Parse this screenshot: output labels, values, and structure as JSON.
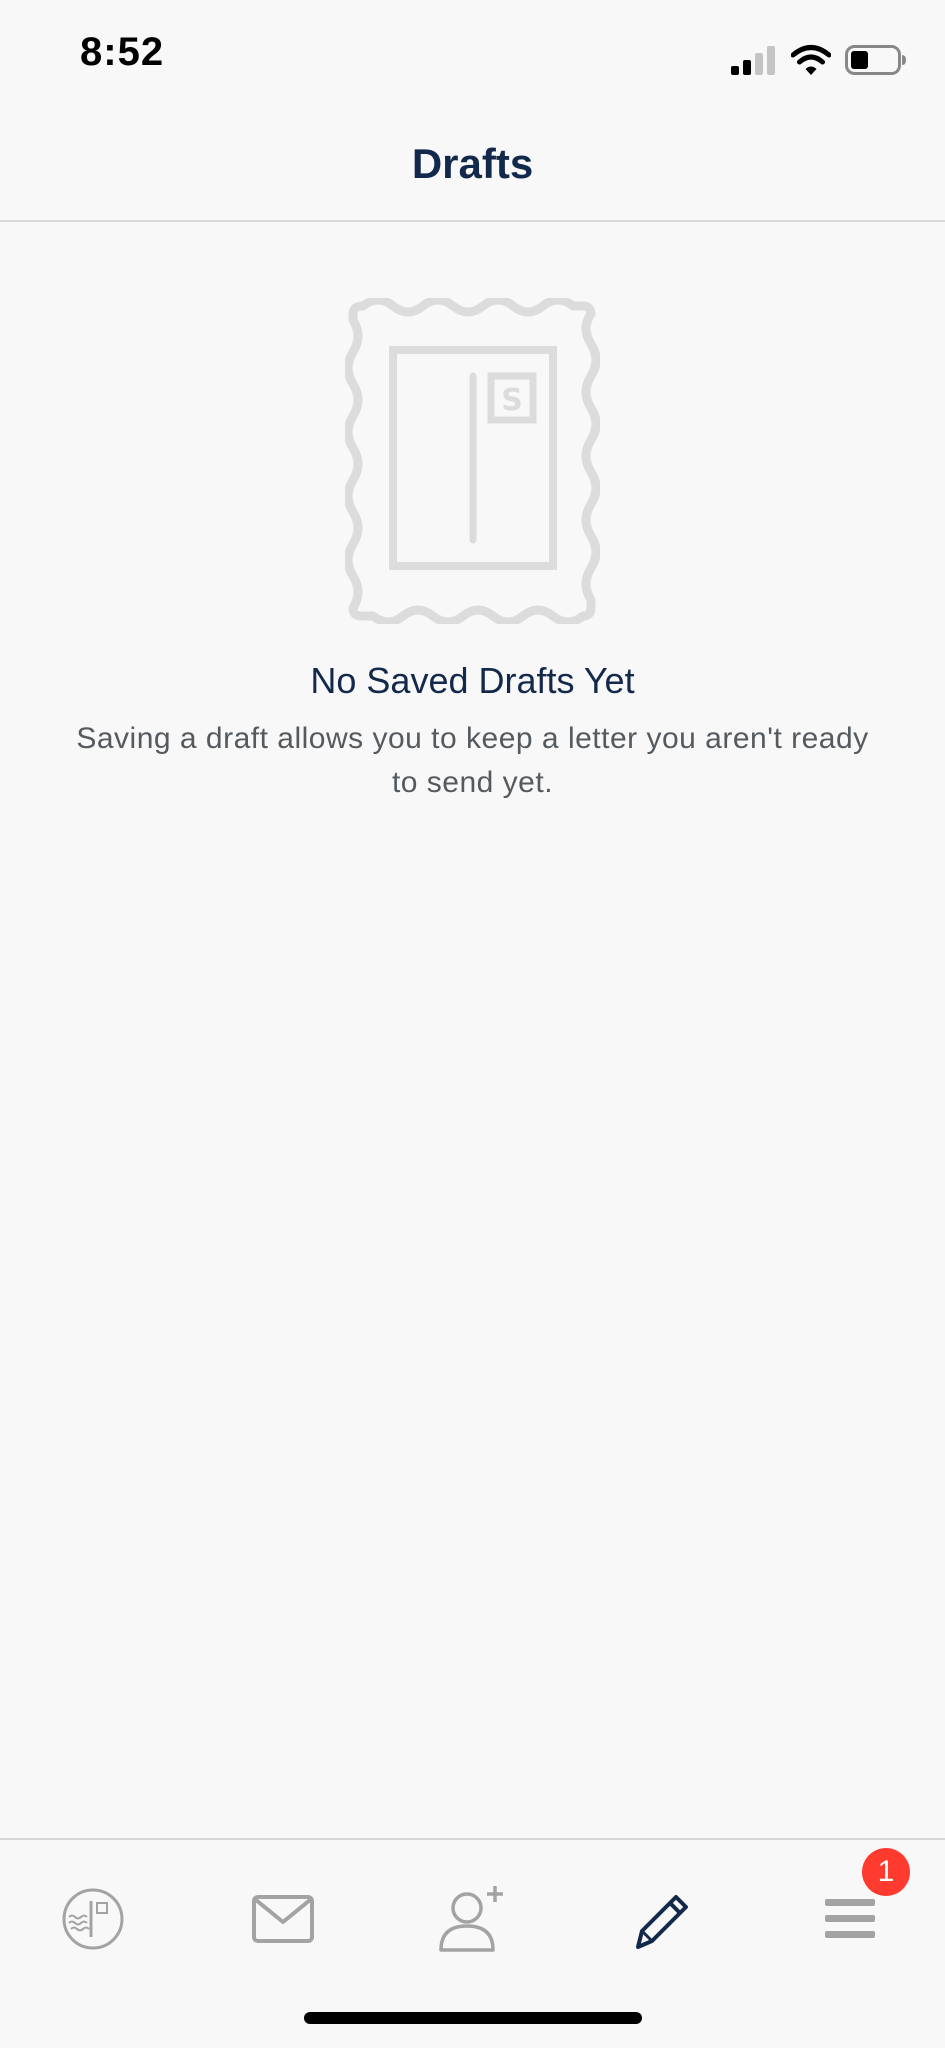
{
  "status_bar": {
    "time": "8:52"
  },
  "nav": {
    "title": "Drafts"
  },
  "empty_state": {
    "title": "No Saved Drafts Yet",
    "description": "Saving a draft allows you to keep a letter you aren't ready to send yet."
  },
  "tab_bar": {
    "tabs": [
      {
        "icon": "stamp-circle-icon",
        "active": false
      },
      {
        "icon": "envelope-icon",
        "active": false
      },
      {
        "icon": "add-contact-icon",
        "active": false
      },
      {
        "icon": "pencil-icon",
        "active": true
      },
      {
        "icon": "menu-icon",
        "active": false
      }
    ],
    "menu_badge": "1"
  },
  "colors": {
    "title": "#13294b",
    "body_text": "#555a5f",
    "icon_inactive": "#a3a3a3",
    "illustration": "#dcdcdc",
    "badge": "#ff3b30",
    "background": "#f8f8f8"
  }
}
